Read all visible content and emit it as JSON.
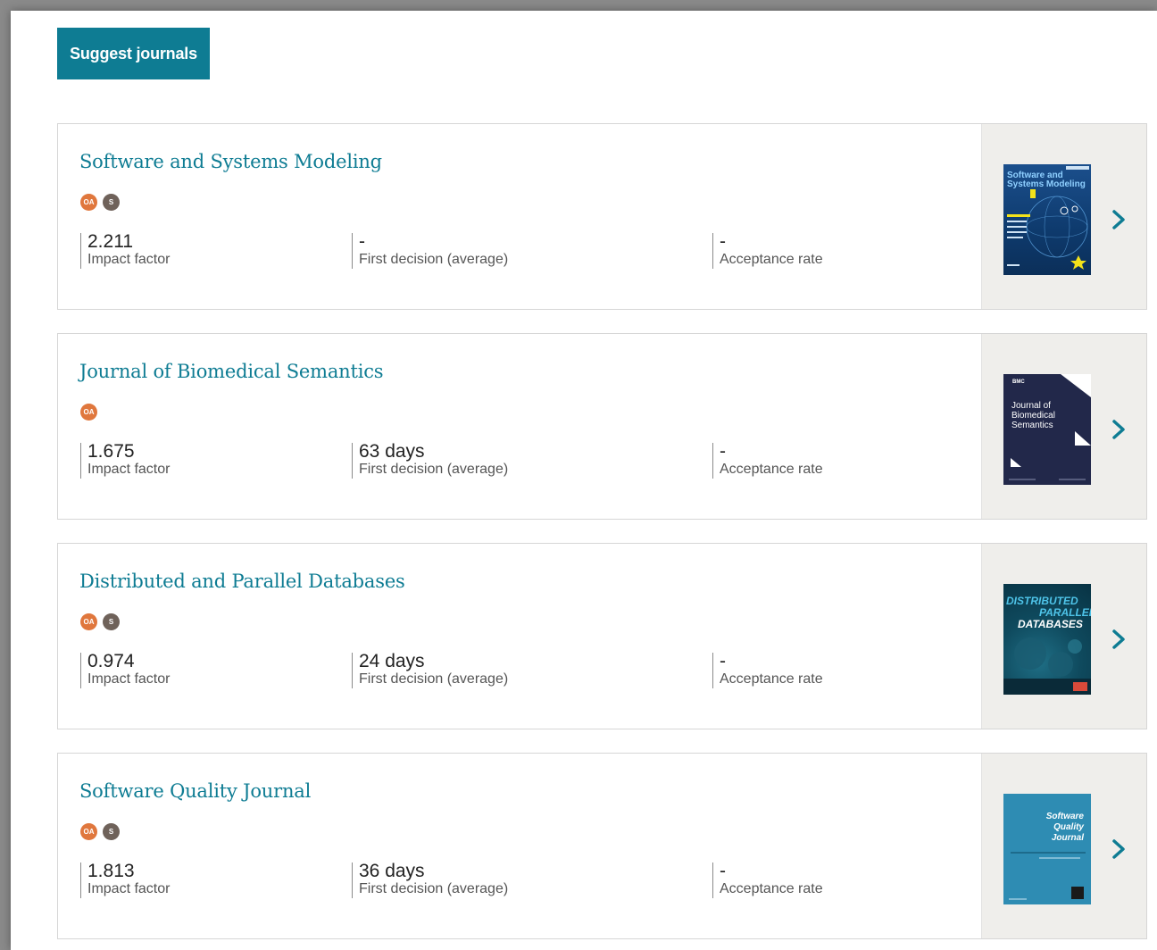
{
  "suggest_button": {
    "label": "Suggest journals"
  },
  "colors": {
    "accent": "#0e7c93",
    "oa_badge": "#e0773d",
    "s_badge": "#6f625a"
  },
  "journals": [
    {
      "title": "Software and Systems Modeling",
      "badges": [
        "OA",
        "S"
      ],
      "impact_factor": "2.211",
      "impact_label": "Impact factor",
      "first_decision": "-",
      "first_decision_label": "First decision (average)",
      "acceptance_rate": "-",
      "acceptance_label": "Acceptance rate",
      "cover_text": "Software and Systems Modeling"
    },
    {
      "title": "Journal of Biomedical Semantics",
      "badges": [
        "OA"
      ],
      "impact_factor": "1.675",
      "impact_label": "Impact factor",
      "first_decision": "63 days",
      "first_decision_label": "First decision (average)",
      "acceptance_rate": "-",
      "acceptance_label": "Acceptance rate",
      "cover_text": "Journal of Biomedical Semantics",
      "cover_brand": "BMC"
    },
    {
      "title": "Distributed and Parallel Databases",
      "badges": [
        "OA",
        "S"
      ],
      "impact_factor": "0.974",
      "impact_label": "Impact factor",
      "first_decision": "24 days",
      "first_decision_label": "First decision (average)",
      "acceptance_rate": "-",
      "acceptance_label": "Acceptance rate",
      "cover_text_1": "DISTRIBUTED",
      "cover_text_2": "PARALLEL",
      "cover_text_3": "DATABASES"
    },
    {
      "title": "Software Quality Journal",
      "badges": [
        "OA",
        "S"
      ],
      "impact_factor": "1.813",
      "impact_label": "Impact factor",
      "first_decision": "36 days",
      "first_decision_label": "First decision (average)",
      "acceptance_rate": "-",
      "acceptance_label": "Acceptance rate",
      "cover_text": "Software Quality Journal"
    }
  ]
}
